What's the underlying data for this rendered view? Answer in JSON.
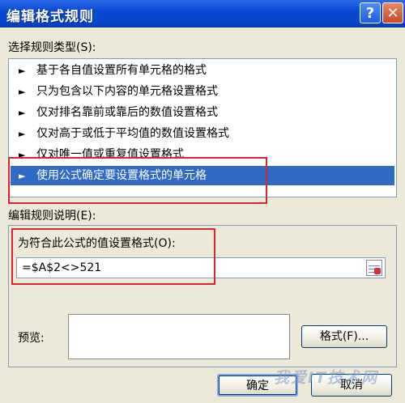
{
  "dialog": {
    "title": "编辑格式规则",
    "help_label": "?",
    "close_label": "✕"
  },
  "rule_type": {
    "label": "选择规则类型(S):",
    "items": [
      {
        "label": "基于各自值设置所有单元格的格式",
        "selected": false
      },
      {
        "label": "只为包含以下内容的单元格设置格式",
        "selected": false
      },
      {
        "label": "仅对排名靠前或靠后的数值设置格式",
        "selected": false
      },
      {
        "label": "仅对高于或低于平均值的数值设置格式",
        "selected": false
      },
      {
        "label": "仅对唯一值或重复值设置格式",
        "selected": false
      },
      {
        "label": "使用公式确定要设置格式的单元格",
        "selected": true
      }
    ],
    "arrow_glyph": "►"
  },
  "description": {
    "label": "编辑规则说明(E):",
    "formula_label": "为符合此公式的值设置格式(O):",
    "formula_value": "=$A$2<>521",
    "preview_label": "预览:",
    "format_button": "格式(F)..."
  },
  "footer": {
    "ok_label": "确定",
    "cancel_label": "取消"
  },
  "watermark": "我爱IT技术网",
  "colors": {
    "titlebar": "#0846c9",
    "selection": "#316ac5",
    "highlight_box": "#d7262c"
  }
}
